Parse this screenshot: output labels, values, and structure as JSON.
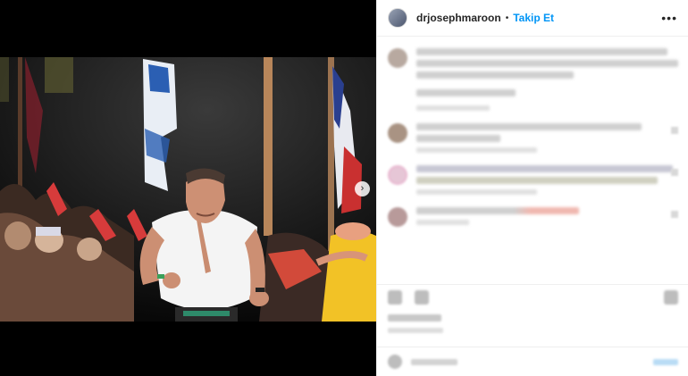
{
  "header": {
    "username": "drjosephmaroon",
    "separator": "•",
    "follow_label": "Takip Et",
    "more_icon": "more-horizontal-icon"
  },
  "media": {
    "next_icon": "chevron-right-icon",
    "next_glyph": "›"
  },
  "colors": {
    "accent": "#0095f6",
    "text": "#262626",
    "border": "#efefef"
  }
}
